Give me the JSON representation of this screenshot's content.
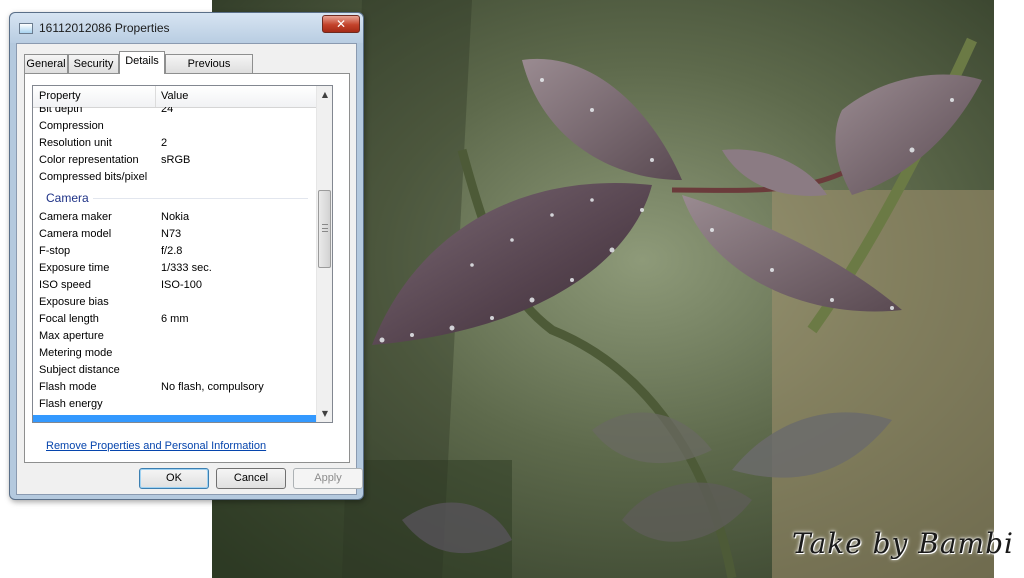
{
  "window": {
    "title": "16112012086 Properties",
    "close_glyph": "✕"
  },
  "tabs": [
    {
      "label": "General",
      "active": false
    },
    {
      "label": "Security",
      "active": false
    },
    {
      "label": "Details",
      "active": true
    },
    {
      "label": "Previous Versions",
      "active": false
    }
  ],
  "list": {
    "header": {
      "property": "Property",
      "value": "Value"
    },
    "rows": [
      {
        "property": "Bit depth",
        "value": "24"
      },
      {
        "property": "Compression",
        "value": ""
      },
      {
        "property": "Resolution unit",
        "value": "2"
      },
      {
        "property": "Color representation",
        "value": "sRGB"
      },
      {
        "property": "Compressed bits/pixel",
        "value": ""
      },
      {
        "group": "Camera"
      },
      {
        "property": "Camera maker",
        "value": "Nokia"
      },
      {
        "property": "Camera model",
        "value": "N73"
      },
      {
        "property": "F-stop",
        "value": "f/2.8"
      },
      {
        "property": "Exposure time",
        "value": "1/333 sec."
      },
      {
        "property": "ISO speed",
        "value": "ISO-100"
      },
      {
        "property": "Exposure bias",
        "value": ""
      },
      {
        "property": "Focal length",
        "value": "6 mm"
      },
      {
        "property": "Max aperture",
        "value": ""
      },
      {
        "property": "Metering mode",
        "value": ""
      },
      {
        "property": "Subject distance",
        "value": ""
      },
      {
        "property": "Flash mode",
        "value": "No flash, compulsory"
      },
      {
        "property": "Flash energy",
        "value": ""
      },
      {
        "property": "",
        "value": "",
        "selected": true
      }
    ],
    "scroll_up_glyph": "▲",
    "scroll_down_glyph": "▼"
  },
  "remove_link": "Remove Properties and Personal Information",
  "buttons": {
    "ok": "OK",
    "cancel": "Cancel",
    "apply": "Apply"
  },
  "watermark": "Take by Bambi",
  "icons": {
    "title": "picture-file-icon",
    "close": "close-icon"
  },
  "colors": {
    "selection": "#3399ff",
    "group_header": "#1e3287",
    "link": "#0645ad",
    "close_button": "#c3422b"
  }
}
